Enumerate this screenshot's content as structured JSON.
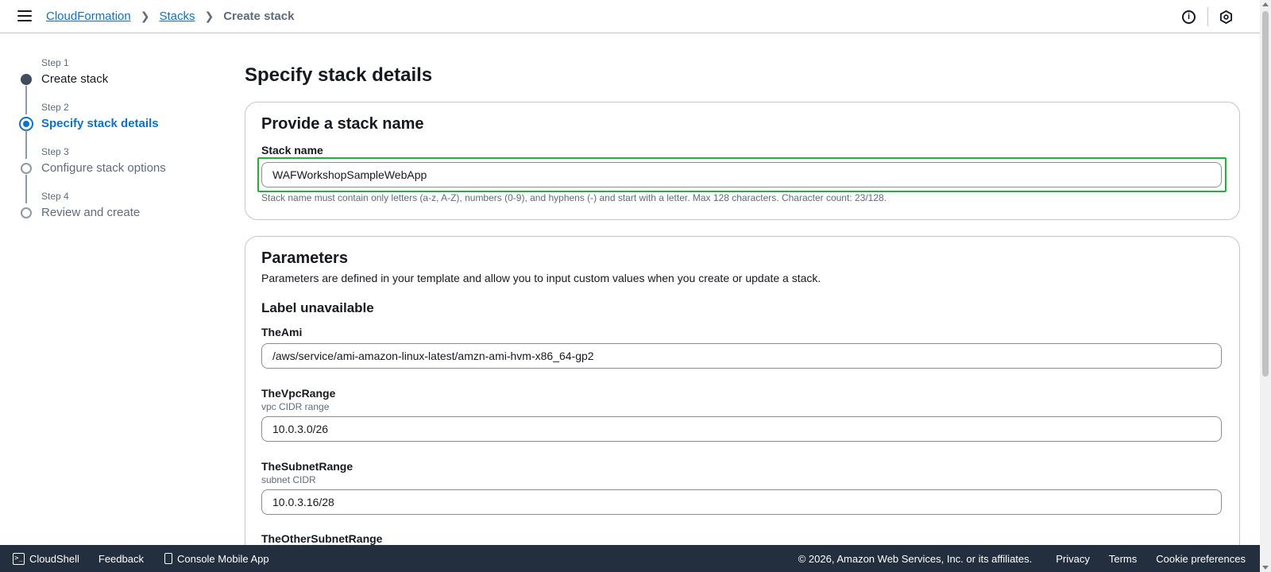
{
  "breadcrumb": {
    "items": [
      "CloudFormation",
      "Stacks"
    ],
    "current": "Create stack"
  },
  "steps": [
    {
      "num": "Step 1",
      "title": "Create stack",
      "state": "done"
    },
    {
      "num": "Step 2",
      "title": "Specify stack details",
      "state": "active"
    },
    {
      "num": "Step 3",
      "title": "Configure stack options",
      "state": "pending"
    },
    {
      "num": "Step 4",
      "title": "Review and create",
      "state": "pending"
    }
  ],
  "main": {
    "page_title": "Specify stack details",
    "stack_name_section": {
      "title": "Provide a stack name",
      "label": "Stack name",
      "value": "WAFWorkshopSampleWebApp",
      "constraint": "Stack name must contain only letters (a-z, A-Z), numbers (0-9), and hyphens (-) and start with a letter. Max 128 characters. Character count: 23/128."
    },
    "parameters_section": {
      "title": "Parameters",
      "description": "Parameters are defined in your template and allow you to input custom values when you create or update a stack.",
      "group_label": "Label unavailable",
      "params": [
        {
          "name": "TheAmi",
          "desc": "",
          "value": "/aws/service/ami-amazon-linux-latest/amzn-ami-hvm-x86_64-gp2"
        },
        {
          "name": "TheVpcRange",
          "desc": "vpc CIDR range",
          "value": "10.0.3.0/26"
        },
        {
          "name": "TheSubnetRange",
          "desc": "subnet CIDR",
          "value": "10.0.3.16/28"
        },
        {
          "name": "TheOtherSubnetRange",
          "desc": "",
          "value": ""
        }
      ]
    }
  },
  "footer": {
    "cloudshell": "CloudShell",
    "feedback": "Feedback",
    "mobile_app": "Console Mobile App",
    "copyright": "© 2026, Amazon Web Services, Inc. or its affiliates.",
    "privacy": "Privacy",
    "terms": "Terms",
    "cookies": "Cookie preferences"
  },
  "icons": {
    "menu": "hamburger-icon",
    "info": "info-icon",
    "settings": "hexagon-icon",
    "cloudshell": "terminal-icon",
    "mobile": "mobile-icon"
  },
  "colors": {
    "link": "#0972d3",
    "focus": "#1db33d",
    "footer_bg": "#232f3e"
  }
}
